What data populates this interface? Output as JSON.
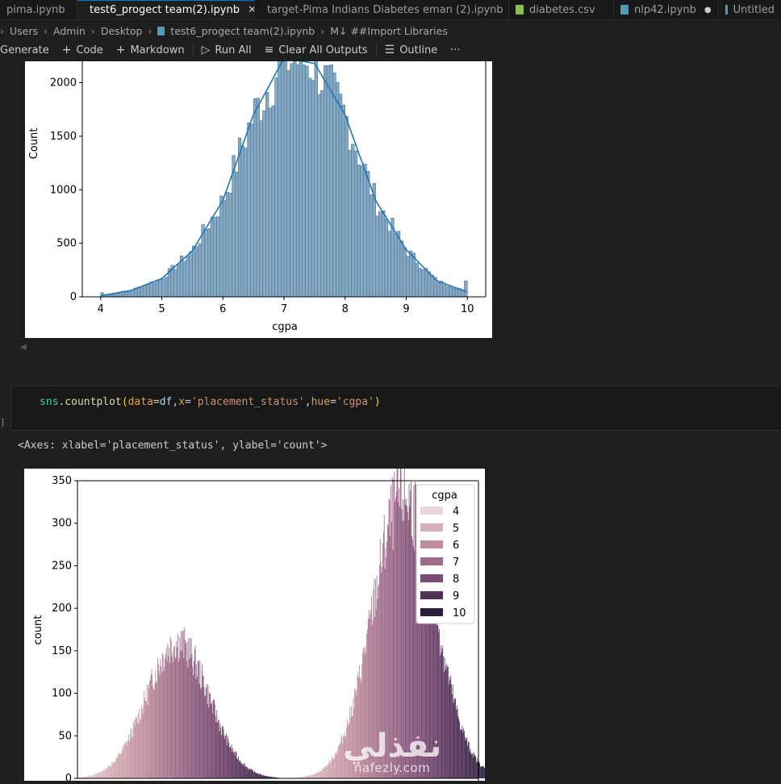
{
  "tabs": [
    {
      "label": "pima.ipynb",
      "icon": "notebook-icon",
      "active": false
    },
    {
      "label": "test6_progect team(2).ipynb",
      "icon": "notebook-icon",
      "active": true,
      "close": "✕"
    },
    {
      "label": "target-Pima Indians Diabetes eman (2).ipynb",
      "icon": "notebook-icon",
      "active": false
    },
    {
      "label": "diabetes.csv",
      "icon": "csv-icon",
      "active": false
    },
    {
      "label": "nlp42.ipynb",
      "icon": "notebook-icon",
      "active": false,
      "modified": "●"
    },
    {
      "label": "Untitled",
      "icon": "notebook-icon",
      "active": false
    }
  ],
  "breadcrumb": {
    "items": [
      "Users",
      "Admin",
      "Desktop",
      "test6_progect team(2).ipynb"
    ],
    "section": "M↓ ##Import Libraries"
  },
  "toolbar": {
    "generate": "Generate",
    "code": "Code",
    "markdown": "Markdown",
    "run_all": "Run All",
    "clear_all": "Clear All Outputs",
    "outline": "Outline",
    "more": "···"
  },
  "cell": {
    "code": "sns.countplot(data=df,x='placement_status',hue='cgpa')",
    "exec_count": "]",
    "result": "<Axes: xlabel='placement_status', ylabel='count'>"
  },
  "colors": {
    "hist_fill": "#86a8c2",
    "hist_edge": "#3e6f93",
    "kde": "#1f77b4",
    "hue_light": "#e8d5d8",
    "hue_dark": "#2a1e3c"
  },
  "chart_data": [
    {
      "type": "bar",
      "title": "",
      "xlabel": "cgpa",
      "ylabel": "Count",
      "xticks": [
        "4",
        "5",
        "6",
        "7",
        "8",
        "9",
        "10"
      ],
      "yticks": [
        "0",
        "500",
        "1000",
        "1500",
        "2000"
      ],
      "xlim": [
        3.7,
        10.3
      ],
      "ylim": [
        0,
        2200
      ],
      "kde_x": [
        4.0,
        4.5,
        5.0,
        5.5,
        6.0,
        6.5,
        7.0,
        7.5,
        8.0,
        8.5,
        9.0,
        9.5,
        10.0
      ],
      "kde_y": [
        10,
        60,
        170,
        430,
        900,
        1700,
        2230,
        2180,
        1700,
        900,
        440,
        150,
        45
      ],
      "grid": false
    },
    {
      "type": "bar",
      "title": "",
      "xlabel": "",
      "ylabel": "count",
      "yticks": [
        "0",
        "50",
        "100",
        "150",
        "200",
        "250",
        "300",
        "350"
      ],
      "ylim": [
        0,
        350
      ],
      "legend_title": "cgpa",
      "legend_position": "top-right",
      "legend": [
        {
          "label": "4",
          "color": "#e8d5d8"
        },
        {
          "label": "5",
          "color": "#d7afb6"
        },
        {
          "label": "6",
          "color": "#c08d9e"
        },
        {
          "label": "7",
          "color": "#9e6b8a"
        },
        {
          "label": "8",
          "color": "#7b4d73"
        },
        {
          "label": "9",
          "color": "#53325a"
        },
        {
          "label": "10",
          "color": "#2a1e3c"
        }
      ],
      "groups": [
        {
          "peak_count": 160,
          "cgpa_range": [
            4,
            10
          ],
          "peak_cgpa": 7.0
        },
        {
          "peak_count": 332,
          "cgpa_range": [
            4,
            10
          ],
          "peak_cgpa": 7.5
        }
      ],
      "grid": false
    }
  ]
}
